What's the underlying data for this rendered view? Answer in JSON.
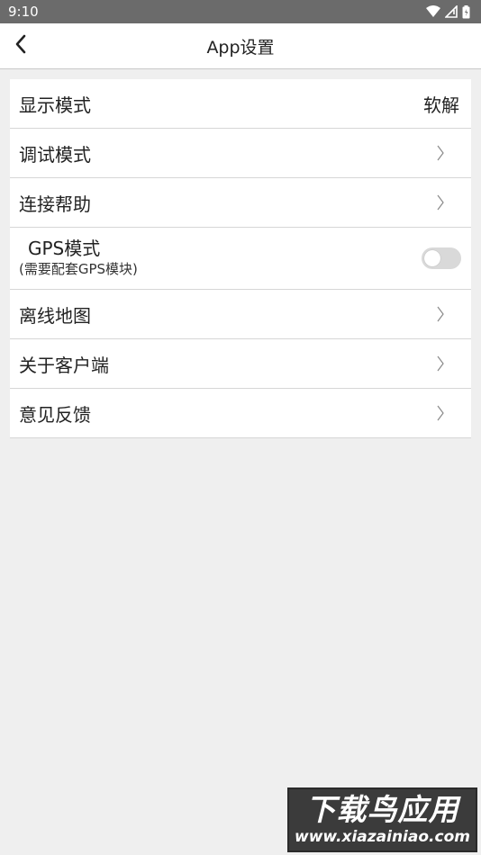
{
  "status_bar": {
    "time": "9:10",
    "icons": [
      "wifi-icon",
      "signal-icon",
      "battery-icon"
    ]
  },
  "header": {
    "title": "App设置",
    "back_icon": "chevron-left-icon"
  },
  "settings": {
    "display_mode": {
      "label": "显示模式",
      "value": "软解"
    },
    "debug_mode": {
      "label": "调试模式"
    },
    "connect_help": {
      "label": "连接帮助"
    },
    "gps_mode": {
      "label": "GPS模式",
      "sublabel": "(需要配套GPS模块)",
      "enabled": false
    },
    "offline_map": {
      "label": "离线地图"
    },
    "about_client": {
      "label": "关于客户端"
    },
    "feedback": {
      "label": "意见反馈"
    }
  },
  "watermark": {
    "text": "下载鸟应用",
    "url": "www.xiazainiao.com"
  },
  "colors": {
    "status_bar": "#6b6b6b",
    "background": "#efefef",
    "toggle_off": "#d9d9d9"
  }
}
